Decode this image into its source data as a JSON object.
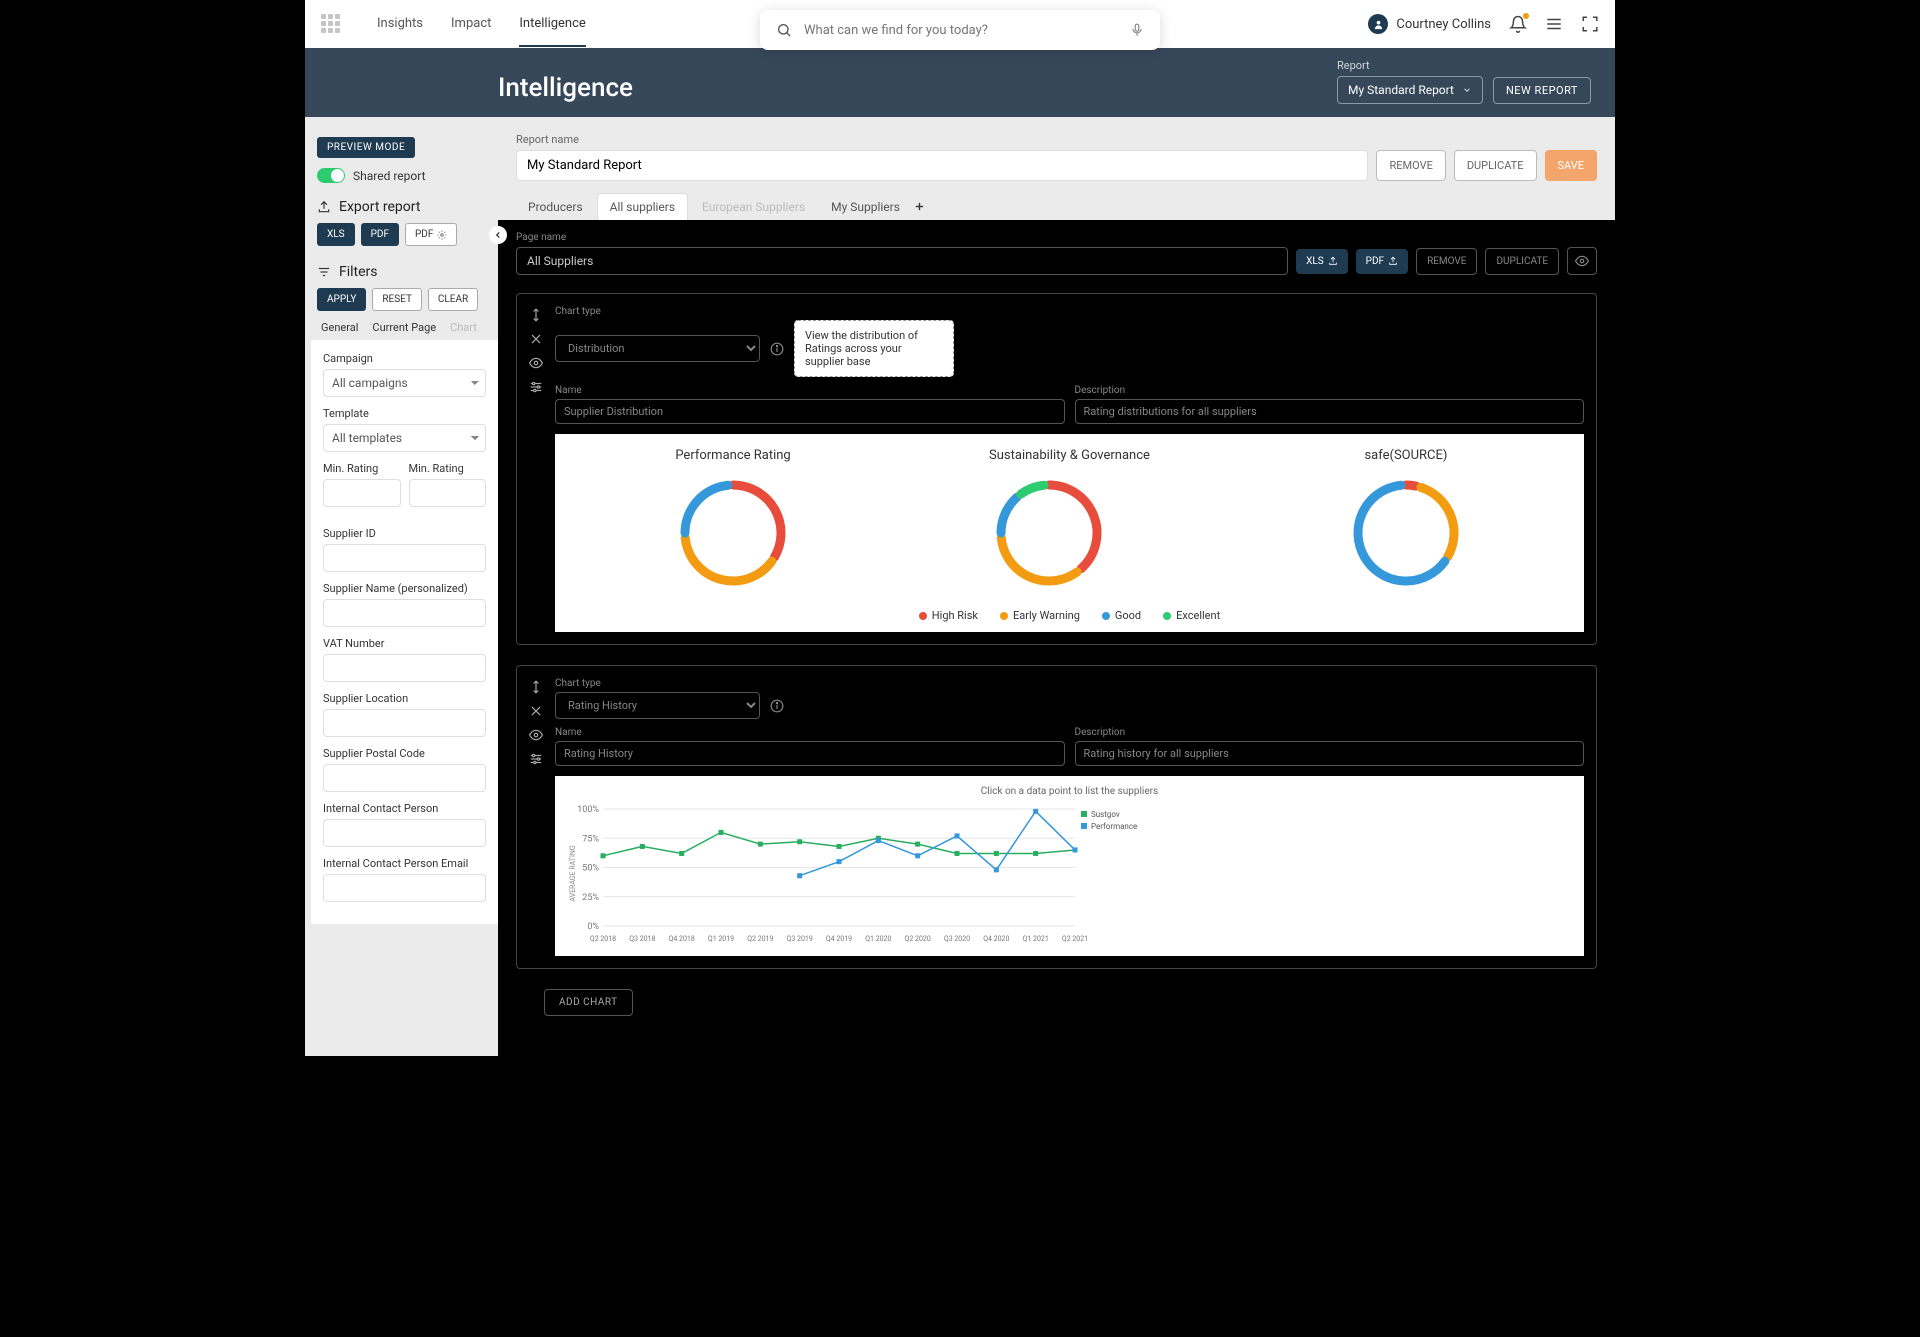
{
  "nav": {
    "links": [
      "Insights",
      "Impact",
      "Intelligence"
    ],
    "search_placeholder": "What can we find for you today?",
    "user": "Courtney Collins"
  },
  "hero": {
    "title": "Intelligence",
    "report_label": "Report",
    "report_selected": "My Standard Report",
    "new_report": "NEW REPORT"
  },
  "sidebar": {
    "preview": "PREVIEW MODE",
    "shared": "Shared report",
    "export": "Export report",
    "xls": "XLS",
    "pdf": "PDF",
    "pdf_settings": "PDF",
    "filters": "Filters",
    "apply": "APPLY",
    "reset": "RESET",
    "clear": "CLEAR",
    "tabs": {
      "general": "General",
      "current": "Current Page",
      "chart": "Chart"
    },
    "fields": {
      "campaign": "Campaign",
      "campaign_val": "All campaigns",
      "template": "Template",
      "template_val": "All templates",
      "min_rating": "Min. Rating",
      "supplier_id": "Supplier ID",
      "supplier_name": "Supplier Name (personalized)",
      "vat": "VAT Number",
      "location": "Supplier Location",
      "postal": "Supplier Postal Code",
      "contact": "Internal Contact Person",
      "contact_email": "Internal Contact Person Email"
    }
  },
  "main": {
    "report_name_label": "Report name",
    "report_name": "My Standard Report",
    "remove": "REMOVE",
    "duplicate": "DUPLICATE",
    "save": "SAVE",
    "tabs": [
      "Producers",
      "All suppliers",
      "European Suppliers",
      "My Suppliers"
    ],
    "page_name_label": "Page name",
    "page_name": "All Suppliers",
    "xls_export": "XLS",
    "pdf_export": "PDF",
    "add_chart": "ADD CHART"
  },
  "chart1": {
    "chart_type_label": "Chart type",
    "chart_type": "Distribution",
    "tooltip": "View the distribution of Ratings across your supplier base",
    "name_label": "Name",
    "name": "Supplier Distribution",
    "desc_label": "Description",
    "desc": "Rating distributions for all suppliers",
    "donuts": {
      "t1": "Performance Rating",
      "t2": "Sustainability & Governance",
      "t3": "safe(SOURCE)"
    },
    "legend": {
      "high": "High Risk",
      "early": "Early Warning",
      "good": "Good",
      "excellent": "Excellent"
    }
  },
  "chart2": {
    "chart_type_label": "Chart type",
    "chart_type": "Rating History",
    "name_label": "Name",
    "name": "Rating History",
    "desc_label": "Description",
    "desc": "Rating history for all suppliers",
    "hint": "Click on a data point to list the suppliers",
    "legend": {
      "sust": "Sustgov",
      "perf": "Performance"
    }
  },
  "chart_data": [
    {
      "type": "pie",
      "title": "Performance Rating",
      "series": [
        {
          "name": "High Risk",
          "value": 35,
          "color": "#e74c3c"
        },
        {
          "name": "Early Warning",
          "value": 40,
          "color": "#f39c12"
        },
        {
          "name": "Good",
          "value": 25,
          "color": "#3498db"
        }
      ]
    },
    {
      "type": "pie",
      "title": "Sustainability & Governance",
      "series": [
        {
          "name": "High Risk",
          "value": 40,
          "color": "#e74c3c"
        },
        {
          "name": "Early Warning",
          "value": 35,
          "color": "#f39c12"
        },
        {
          "name": "Good",
          "value": 15,
          "color": "#3498db"
        },
        {
          "name": "Excellent",
          "value": 10,
          "color": "#2ecc71"
        }
      ]
    },
    {
      "type": "pie",
      "title": "safe(SOURCE)",
      "series": [
        {
          "name": "High Risk",
          "value": 5,
          "color": "#e74c3c"
        },
        {
          "name": "Early Warning",
          "value": 30,
          "color": "#f39c12"
        },
        {
          "name": "Good",
          "value": 65,
          "color": "#3498db"
        }
      ]
    },
    {
      "type": "line",
      "title": "Rating History",
      "xlabel": "",
      "ylabel": "AVERAGE RATING",
      "ylim": [
        0,
        100
      ],
      "categories": [
        "Q2 2018",
        "Q3 2018",
        "Q4 2018",
        "Q1 2019",
        "Q2 2019",
        "Q3 2019",
        "Q4 2019",
        "Q1 2020",
        "Q2 2020",
        "Q3 2020",
        "Q4 2020",
        "Q1 2021",
        "Q2 2021"
      ],
      "yticks": [
        0,
        25,
        50,
        75,
        100
      ],
      "series": [
        {
          "name": "Sustgov",
          "color": "#27ae60",
          "values": [
            60,
            68,
            62,
            80,
            70,
            72,
            68,
            75,
            70,
            62,
            62,
            62,
            65
          ]
        },
        {
          "name": "Performance",
          "color": "#3498db",
          "values": [
            null,
            null,
            null,
            null,
            null,
            43,
            55,
            73,
            60,
            77,
            48,
            98,
            65
          ]
        }
      ]
    }
  ],
  "colors": {
    "high": "#e74c3c",
    "early": "#f39c12",
    "good": "#3498db",
    "excellent": "#2ecc71"
  }
}
